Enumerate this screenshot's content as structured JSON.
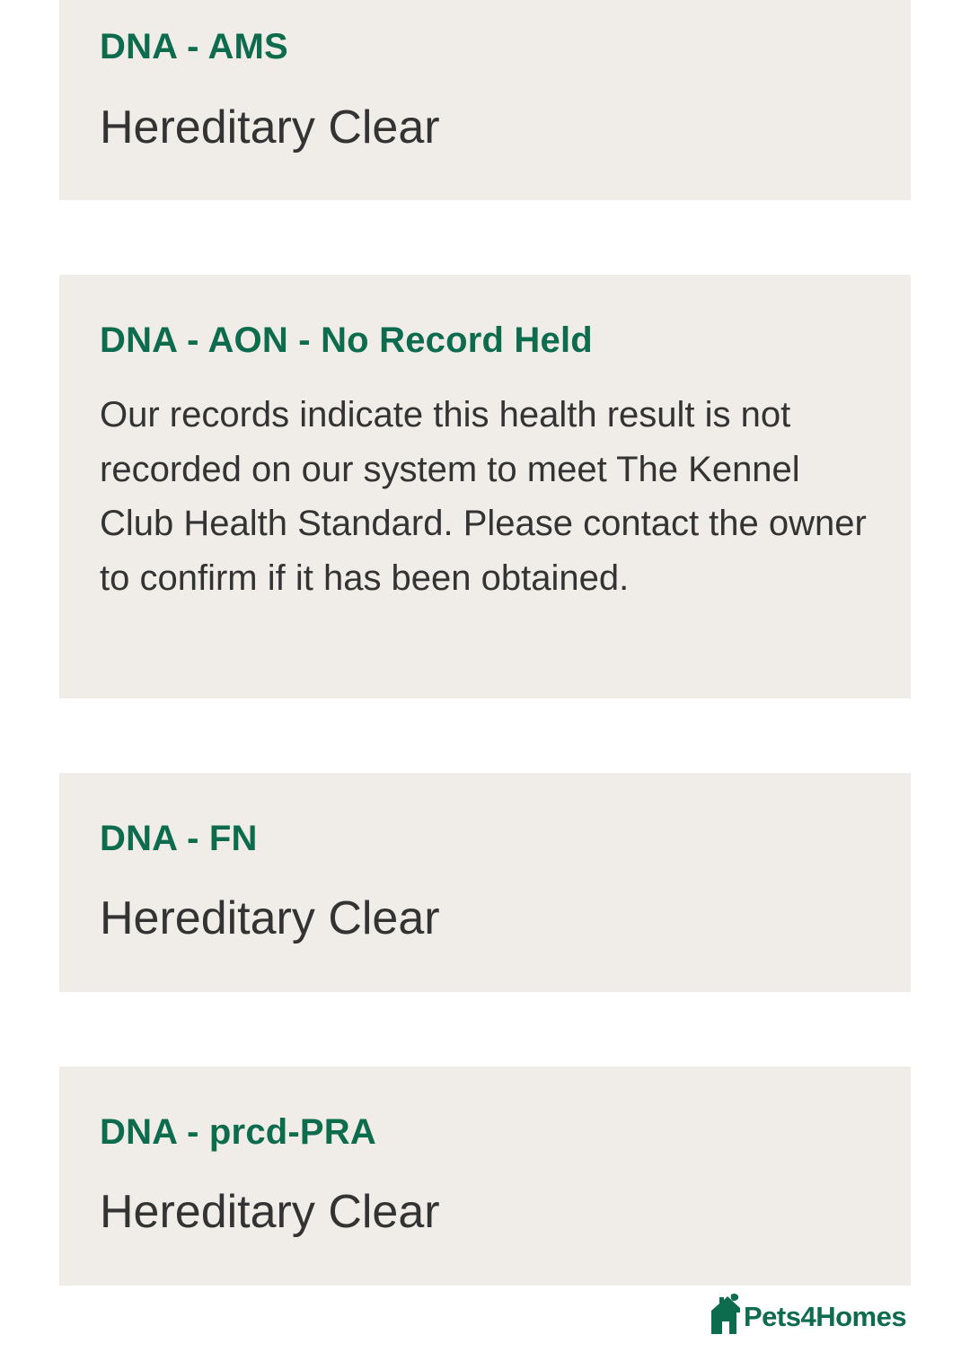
{
  "results": [
    {
      "title": "DNA - AMS",
      "value": "Hereditary Clear"
    },
    {
      "title": "DNA - AON - No Record Held",
      "text": "Our records indicate this health result is not recorded on our system to meet The Kennel Club Health Standard. Please contact the owner to confirm if it has been obtained."
    },
    {
      "title": "DNA - FN",
      "value": "Hereditary Clear"
    },
    {
      "title": "DNA - prcd-PRA",
      "value": "Hereditary Clear"
    }
  ],
  "watermark": {
    "text": "Pets4Homes",
    "icon": "pets4homes-logo-icon"
  },
  "colors": {
    "title": "#0d6b4e",
    "card_bg": "#f0ede8",
    "body_text": "#333333"
  }
}
